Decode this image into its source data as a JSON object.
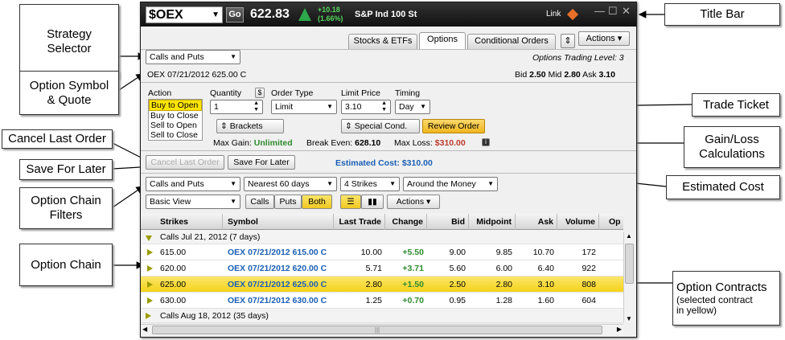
{
  "callouts": {
    "strategy_selector": "Strategy Selector",
    "strategy_selector_l1": "Strategy",
    "strategy_selector_l2": "Selector",
    "option_symbol_l1": "Option Symbol",
    "option_symbol_l2": "& Quote",
    "cancel_last_order": "Cancel Last Order",
    "save_for_later": "Save For Later",
    "chain_filters_l1": "Option Chain",
    "chain_filters_l2": "Filters",
    "option_chain": "Option Chain",
    "title_bar": "Title Bar",
    "trade_ticket": "Trade Ticket",
    "gain_loss_l1": "Gain/Loss",
    "gain_loss_l2": "Calculations",
    "estimated_cost": "Estimated Cost",
    "option_contracts": "Option Contracts",
    "option_contracts_sub1": "(selected contract",
    "option_contracts_sub2": "in yellow)"
  },
  "titlebar": {
    "symbol": "$OEX",
    "go_label": "Go",
    "price": "622.83",
    "change_abs": "+10.18",
    "change_pct": "(1.66%)",
    "index_name": "S&P Ind 100 St",
    "link_label": "Link",
    "min_glyph": "—",
    "max_glyph": "☐",
    "close_glyph": "✕",
    "up_color": "#2ea84a"
  },
  "tabs": {
    "items": [
      "Stocks & ETFs",
      "Options",
      "Conditional Orders"
    ],
    "active": "Options",
    "collapse_glyph": "⇕",
    "actions_label": "Actions ▾"
  },
  "strategy": {
    "selected": "Calls and Puts",
    "trading_level": "Options Trading Level: 3"
  },
  "quote": {
    "contract": "OEX 07/21/2012 625.00 C",
    "bid_label": "Bid",
    "bid": "2.50",
    "mid_label": "Mid",
    "mid": "2.80",
    "ask_label": "Ask",
    "ask": "3.10"
  },
  "ticket": {
    "action_label": "Action",
    "actions": [
      "Buy to Open",
      "Buy to Close",
      "Sell to Open",
      "Sell to Close"
    ],
    "selected_action": "Buy to Open",
    "quantity_label": "Quantity",
    "quantity_value": "1",
    "order_type_label": "Order Type",
    "order_type_value": "Limit",
    "limit_price_label": "Limit Price",
    "limit_price_value": "3.10",
    "timing_label": "Timing",
    "timing_value": "Day",
    "brackets_label": "Brackets",
    "special_cond_label": "Special Cond.",
    "review_label": "Review Order",
    "review_color": "#f5c842"
  },
  "gainloss": {
    "max_gain_label": "Max Gain:",
    "max_gain_value": "Unlimited",
    "break_even_label": "Break Even:",
    "break_even_value": "628.10",
    "max_loss_label": "Max Loss:",
    "max_loss_value": "$310.00",
    "gain_color": "#2e8b2e",
    "loss_color": "#c0392b"
  },
  "order_buttons": {
    "cancel_last": "Cancel Last Order",
    "save_for_later": "Save For Later",
    "estimated_cost": "Estimated Cost: $310.00"
  },
  "filters": {
    "type": "Calls and Puts",
    "expiry": "Nearest 60 days",
    "strikes": "4 Strikes",
    "range": "Around the Money",
    "view": "Basic View",
    "toggle": [
      "Calls",
      "Puts",
      "Both"
    ],
    "toggle_active": "Both",
    "actions_label": "Actions ▾"
  },
  "chain": {
    "columns": [
      "Strikes",
      "Symbol",
      "Last Trade",
      "Change",
      "Bid",
      "Midpoint",
      "Ask",
      "Volume",
      "Op"
    ],
    "groups": [
      {
        "label": "Calls  Jul 21, 2012 (7 days)",
        "expanded": true,
        "rows": [
          {
            "strike": "615.00",
            "symbol": "OEX 07/21/2012 615.00 C",
            "last": "10.00",
            "change": "+5.50",
            "bid": "9.00",
            "mid": "9.85",
            "ask": "10.70",
            "volume": "172",
            "selected": false
          },
          {
            "strike": "620.00",
            "symbol": "OEX 07/21/2012 620.00 C",
            "last": "5.71",
            "change": "+3.71",
            "bid": "5.60",
            "mid": "6.00",
            "ask": "6.40",
            "volume": "922",
            "selected": false
          },
          {
            "strike": "625.00",
            "symbol": "OEX 07/21/2012 625.00 C",
            "last": "2.80",
            "change": "+1.50",
            "bid": "2.50",
            "mid": "2.80",
            "ask": "3.10",
            "volume": "808",
            "selected": true
          },
          {
            "strike": "630.00",
            "symbol": "OEX 07/21/2012 630.00 C",
            "last": "1.25",
            "change": "+0.70",
            "bid": "0.95",
            "mid": "1.28",
            "ask": "1.60",
            "volume": "604",
            "selected": false
          }
        ]
      },
      {
        "label": "Calls  Aug 18, 2012 (35 days)",
        "expanded": false,
        "rows": []
      }
    ],
    "symbol_color": "#1a5fb4",
    "change_color": "#2e8b2e",
    "selected_color": "#f7d830"
  },
  "scroll": {
    "up": "▲",
    "down": "▼",
    "left": "◀",
    "right": "▶",
    "grip": "|||"
  }
}
